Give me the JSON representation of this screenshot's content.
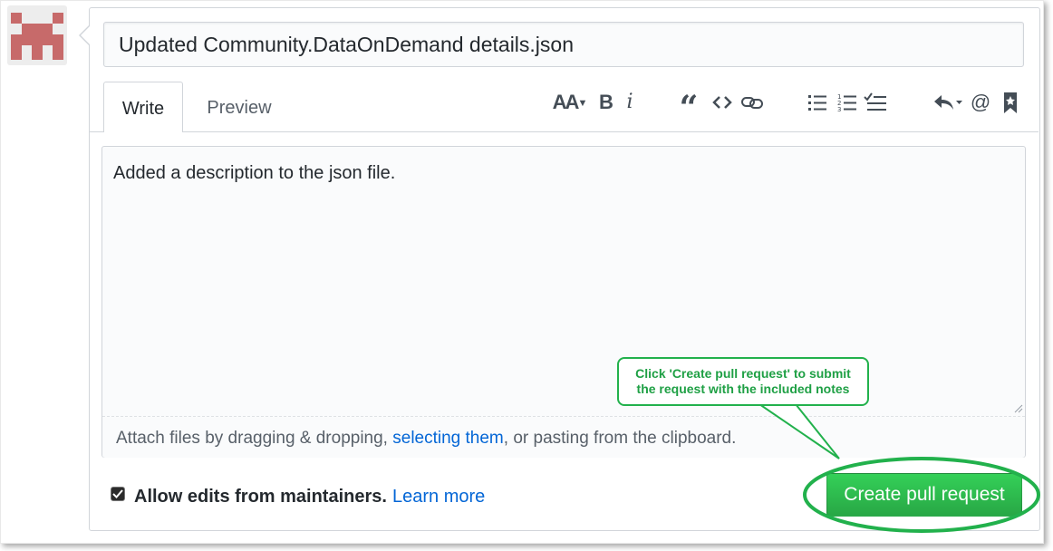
{
  "form": {
    "title_value": "Updated Community.DataOnDemand details.json",
    "tabs": [
      {
        "label": "Write",
        "active": true
      },
      {
        "label": "Preview",
        "active": false
      }
    ],
    "toolbar": {
      "header_label": "AA",
      "bold_label": "B",
      "italic_label": "i",
      "quote_label": "“",
      "mention_label": "@"
    },
    "body_text": "Added a description to the json file.",
    "attach": {
      "prefix": "Attach files by dragging & dropping, ",
      "link": "selecting them",
      "suffix": ", or pasting from the clipboard."
    },
    "allow_edits": {
      "checked": true,
      "label": "Allow edits from maintainers.",
      "learn_more": "Learn more"
    },
    "submit_label": "Create pull request"
  },
  "callout": {
    "line1": "Click 'Create pull request' to submit",
    "line2": "the request with the included notes"
  },
  "colors": {
    "primary_button": "#2ea44f",
    "link": "#0366d6",
    "callout": "#22b14c",
    "avatar": "#c76a6a"
  }
}
